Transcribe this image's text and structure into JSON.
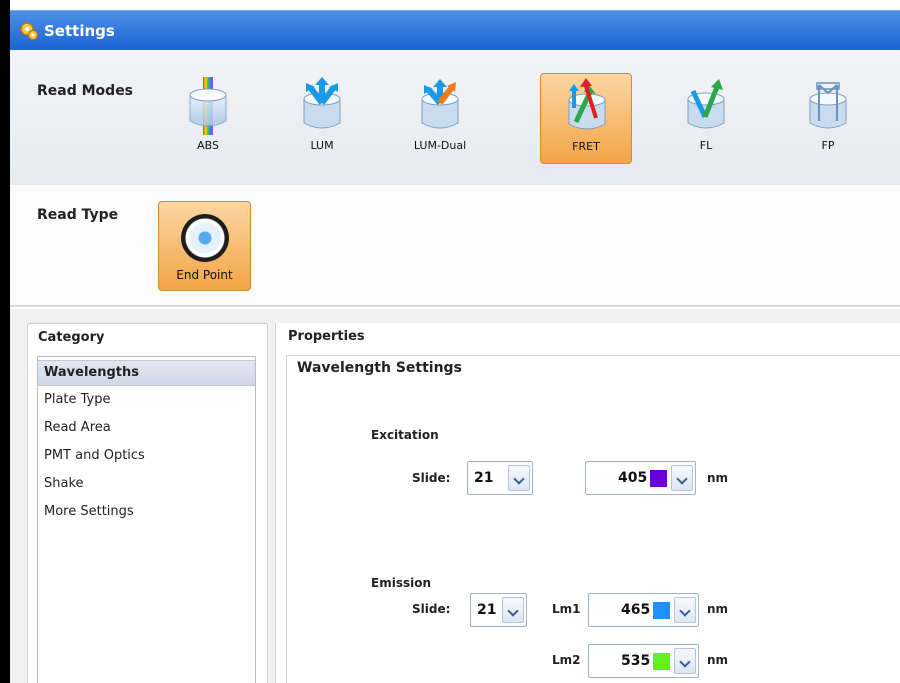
{
  "window": {
    "title": "Settings",
    "title_icon": "gear-icon"
  },
  "read_modes": {
    "label": "Read Modes",
    "items": [
      {
        "label": "ABS",
        "icon": "abs-mode-icon",
        "selected": false
      },
      {
        "label": "LUM",
        "icon": "lum-mode-icon",
        "selected": false
      },
      {
        "label": "LUM-Dual",
        "icon": "lum-dual-mode-icon",
        "selected": false
      },
      {
        "label": "FRET",
        "icon": "fret-mode-icon",
        "selected": true
      },
      {
        "label": "FL",
        "icon": "fl-mode-icon",
        "selected": false
      },
      {
        "label": "FP",
        "icon": "fp-mode-icon",
        "selected": false
      }
    ]
  },
  "read_type": {
    "label": "Read Type",
    "button_label": "End Point",
    "icon": "end-point-icon",
    "selected": true
  },
  "category": {
    "title": "Category",
    "items": [
      "Wavelengths",
      "Plate Type",
      "Read Area",
      "PMT and Optics",
      "Shake",
      "More Settings"
    ],
    "selected": "Wavelengths"
  },
  "properties": {
    "title": "Properties",
    "section_title": "Wavelength Settings",
    "excitation": {
      "label": "Excitation",
      "slide_label": "Slide:",
      "slide_value": "21",
      "wavelength": "405",
      "swatch_color": "#6a00d8",
      "unit": "nm"
    },
    "emission": {
      "label": "Emission",
      "slide_label": "Slide:",
      "slide_value": "21",
      "lm1_label": "Lm1",
      "lm1_value": "465",
      "lm1_color": "#1e90ff",
      "lm2_label": "Lm2",
      "lm2_value": "535",
      "lm2_color": "#66ee22",
      "unit": "nm"
    }
  },
  "colors": {
    "titlebar": "#2a6fdc",
    "selected_button": "#f3a545",
    "accent_text": "#ffffff"
  }
}
